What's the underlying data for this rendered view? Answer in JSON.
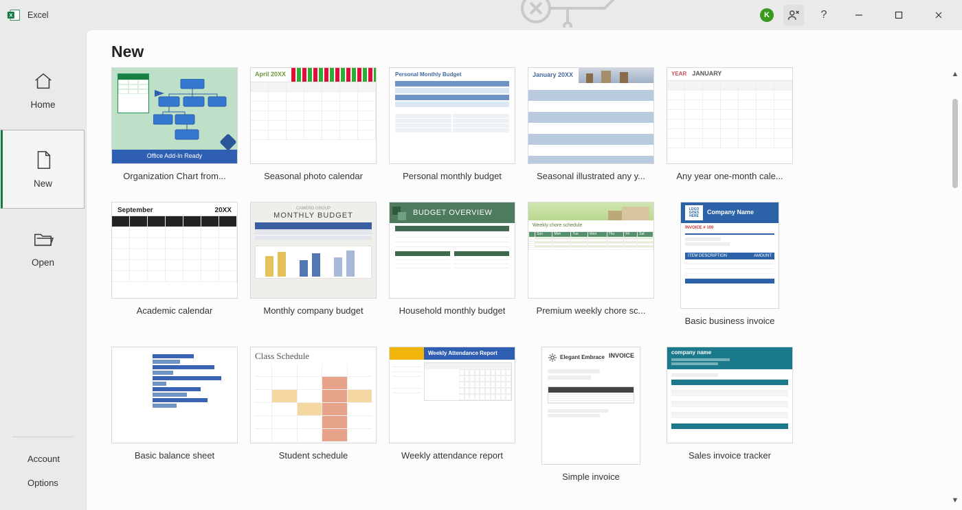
{
  "app": {
    "name": "Excel"
  },
  "titlebar": {
    "user_initial": "K",
    "help_char": "?"
  },
  "sidebar": {
    "home": "Home",
    "new": "New",
    "open": "Open",
    "account": "Account",
    "options": "Options"
  },
  "main": {
    "heading": "New",
    "templates": [
      {
        "label": "Organization Chart from...",
        "thumb": "org_chart",
        "footer": "Office Add-In Ready"
      },
      {
        "label": "Seasonal photo calendar",
        "thumb": "seasonal_cal",
        "month": "April 20XX"
      },
      {
        "label": "Personal monthly budget",
        "thumb": "personal_budget",
        "title": "Personal Monthly Budget"
      },
      {
        "label": "Seasonal illustrated any y...",
        "thumb": "seasonal_year",
        "month": "January 20XX"
      },
      {
        "label": "Any year one-month cale...",
        "thumb": "any_year_cal",
        "year": "YEAR",
        "month": "JANUARY"
      },
      {
        "label": "Academic calendar",
        "thumb": "academic_cal",
        "month": "September",
        "year": "20XX"
      },
      {
        "label": "Monthly company budget",
        "thumb": "company_budget",
        "title": "MONTHLY BUDGET",
        "sub": "CAMERO GROUP"
      },
      {
        "label": "Household monthly budget",
        "thumb": "household_budget",
        "title": "BUDGET OVERVIEW"
      },
      {
        "label": "Premium weekly chore sc...",
        "thumb": "chore",
        "title": "Weekly chore schedule"
      },
      {
        "label": "Basic business invoice",
        "thumb": "biz_invoice",
        "company": "Company Name",
        "logo": "LOGO GOES HERE",
        "section": "ITEM DESCRIPTION",
        "amount": "AMOUNT",
        "invno": "INVOICE # 100"
      },
      {
        "label": "Basic balance sheet",
        "thumb": "balance_sheet"
      },
      {
        "label": "Student schedule",
        "thumb": "student_sched",
        "title": "Class Schedule"
      },
      {
        "label": "Weekly attendance report",
        "thumb": "attendance",
        "title": "Weekly Attendance Report"
      },
      {
        "label": "Simple invoice",
        "thumb": "simple_invoice",
        "company": "Elegant Embrace",
        "word": "INVOICE"
      },
      {
        "label": "Sales invoice tracker",
        "thumb": "sales_tracker",
        "company": "company name"
      }
    ]
  },
  "colors": {
    "excel_green": "#107c41",
    "avatar_green": "#3a9a1f",
    "blue": "#2f5fb3",
    "teal": "#1a7a8c"
  }
}
